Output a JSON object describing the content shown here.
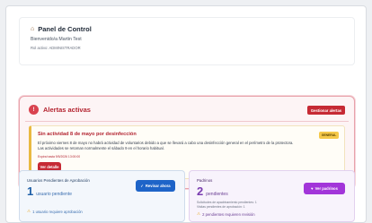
{
  "header": {
    "title": "Panel de Control",
    "title_icon": "home-icon",
    "welcome": "Bienvenido/a Martin Test",
    "role": "Rol activo: ADMINISTRADOR"
  },
  "alerts": {
    "title": "Alertas activas",
    "manage_label": "Gestionar alertas",
    "item": {
      "title": "Sin actividad 8 de mayo por desinfección",
      "badge": "GENERAL",
      "line1": "El próximo viernes 8 de mayo no habrá actividad de voluntarios debido a que se llevará a cabo una desinfección general en el perímetro de la protectora.",
      "line2": "Las actividades se retoman normalmente el sábado 9 en el horario habitual.",
      "expiry": "Expira hasta 9/5/2026 13:00:00",
      "details_label": "Ver detalle"
    }
  },
  "approvals": {
    "title": "Usuarios Pendientes de Aprobación",
    "count": "1",
    "count_label": "usuario pendiente",
    "warning": "1 usuario requiere aprobación",
    "button_label": "Revisar ahora"
  },
  "parents": {
    "title": "Padrinos",
    "count": "2",
    "count_label": "pendientes",
    "line1": "Solicitudes de apadrinamiento pendientes: 1",
    "line2": "Visitas pendientes de aprobación: 1",
    "warning": "2 pendientes requieren revisión",
    "button_label": "Ver padrinos"
  },
  "colors": {
    "alert_red": "#c62a34",
    "badge_yellow": "#f5c84a",
    "approvals_blue": "#1e64c8",
    "parents_purple": "#a235d9"
  }
}
